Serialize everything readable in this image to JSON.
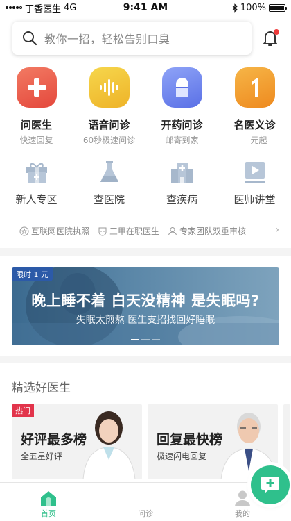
{
  "status_bar": {
    "carrier": "丁香医生",
    "network": "4G",
    "time": "9:41 AM",
    "battery": "100%"
  },
  "search": {
    "placeholder": "教你一招，轻松告别口臭"
  },
  "services": [
    {
      "title": "问医生",
      "sub": "快速回复",
      "icon": "plus-icon",
      "color": "#ec5f4d"
    },
    {
      "title": "语音问诊",
      "sub": "60秒极速问诊",
      "icon": "voice-wave-icon",
      "color": "#f1c234"
    },
    {
      "title": "开药问诊",
      "sub": "邮寄到家",
      "icon": "pill-capsule-icon",
      "color": "#6f87f0"
    },
    {
      "title": "名医义诊",
      "sub": "一元起",
      "icon": "number-one-icon",
      "color": "#f29b2b"
    }
  ],
  "shortcuts": [
    {
      "label": "新人专区",
      "icon": "gift-box-icon"
    },
    {
      "label": "查医院",
      "icon": "flask-icon"
    },
    {
      "label": "查疾病",
      "icon": "hospital-building-icon"
    },
    {
      "label": "医师讲堂",
      "icon": "video-play-icon"
    }
  ],
  "trust": [
    {
      "label": "互联网医院执照",
      "icon": "certificate-icon"
    },
    {
      "label": "三甲在职医生",
      "icon": "doctor-badge-icon"
    },
    {
      "label": "专家团队双重审核",
      "icon": "person-icon"
    }
  ],
  "banner": {
    "tag": "限时 1 元",
    "title": "晚上睡不着 白天没精神 是失眠吗?",
    "subtitle": "失眠太煎熬 医生支招找回好睡眠"
  },
  "doctors_section": {
    "title": "精选好医生",
    "cards": [
      {
        "tag": "热门",
        "title": "好评最多榜",
        "sub": "全五星好评"
      },
      {
        "tag": "",
        "title": "回复最快榜",
        "sub": "极速闪电回复"
      }
    ]
  },
  "tabbar": {
    "items": [
      {
        "label": "首页",
        "icon": "home-icon",
        "active": true
      },
      {
        "label": "问诊",
        "icon": "consult-chat-icon",
        "active": false
      },
      {
        "label": "我的",
        "icon": "profile-icon",
        "active": false
      }
    ]
  },
  "colors": {
    "accent_green": "#2fc08c",
    "badge_red": "#e2344b",
    "notification_dot": "#ee3b3b"
  }
}
